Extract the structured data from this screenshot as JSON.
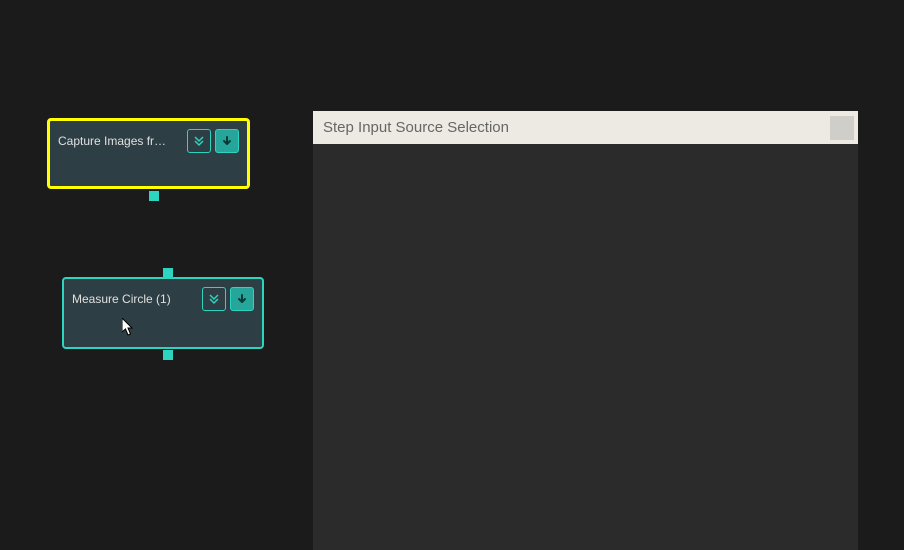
{
  "nodes": {
    "capture": {
      "label": "Capture Images fro…"
    },
    "measure": {
      "label": "Measure Circle (1)"
    }
  },
  "panel": {
    "title": "Step Input Source Selection"
  }
}
